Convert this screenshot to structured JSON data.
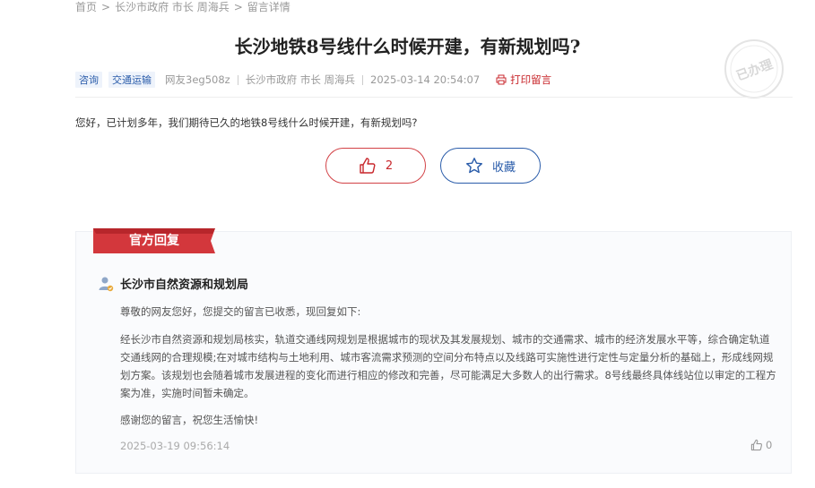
{
  "breadcrumb": {
    "home": "首页",
    "sep": ">",
    "recipient": "长沙市政府 市长 周海兵",
    "current": "留言详情"
  },
  "title": "长沙地铁8号线什么时候开建，有新规划吗?",
  "meta": {
    "tags": [
      "咨询",
      "交通运输"
    ],
    "author": "网友3eg508z",
    "recipient": "长沙市政府 市长 周海兵",
    "datetime": "2025-03-14 20:54:07",
    "print_label": "打印留言"
  },
  "stamp_text": "已办理",
  "question": "您好，已计划多年，我们期待已久的地铁8号线什么时候开建，有新规划吗?",
  "actions": {
    "like_count": "2",
    "favorite_label": "收藏"
  },
  "reply": {
    "banner": "官方回复",
    "department": "长沙市自然资源和规划局",
    "greeting": "尊敬的网友您好，您提交的留言已收悉，现回复如下:",
    "body_lines": [
      "经长沙市自然资源和规划局核实，轨道交通线网规划是根据城市的现状及其发展规划、城市的交通需求、城市的经济发展水平等，综合确定轨道",
      "交通线网的合理规模;在对城市结构与土地利用、城市客流需求预测的空间分布特点以及线路可实施性进行定性与定量分析的基础上，形成线网规",
      "划方案。该规划也会随着城市发展进程的变化而进行相应的修改和完善，尽可能满足大多数人的出行需求。8号线最终具体线站位以审定的工程方",
      "案为准，实施时间暂未确定。"
    ],
    "thanks": "感谢您的留言，祝您生活愉快!",
    "date": "2025-03-19 09:56:14",
    "like_count": "0"
  },
  "colors": {
    "accent_red": "#c8272c",
    "accent_blue": "#2a5caa"
  },
  "icons": [
    "thumbs-up-icon",
    "star-icon",
    "printer-icon",
    "user-icon",
    "check-icon"
  ]
}
